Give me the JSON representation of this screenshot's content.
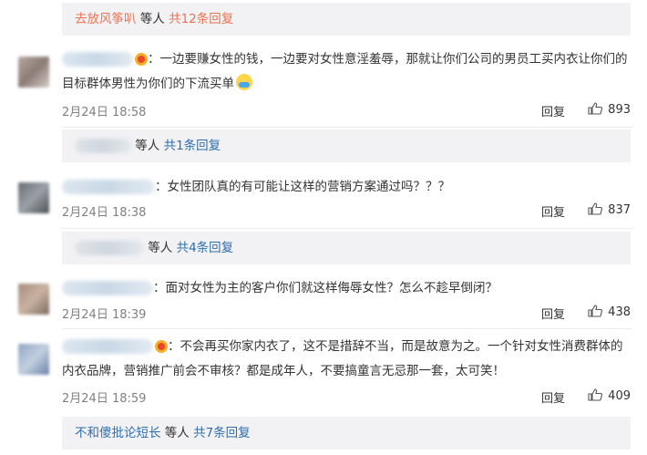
{
  "threads": [
    {
      "reply_user": "去放风筝叭",
      "reply_suffix": "等人",
      "reply_count": "共12条回复"
    },
    {
      "reply_user": "",
      "reply_suffix": "等人",
      "reply_count": "共1条回复"
    },
    {
      "reply_user": "",
      "reply_suffix": "等人",
      "reply_count": "共4条回复"
    },
    {
      "reply_user": "不和傻批论短长",
      "reply_suffix": "等人",
      "reply_count": "共7条回复"
    }
  ],
  "comments": [
    {
      "text": "：一边要赚女性的钱，一边要对女性意淫羞辱，那就让你们公司的男员工买内衣让你们的目标群体男性为你们的下流买单",
      "time": "2月24日 18:58",
      "reply_label": "回复",
      "likes": "893"
    },
    {
      "text": "：女性团队真的有可能让这样的营销方案通过吗？？？",
      "time": "2月24日 18:38",
      "reply_label": "回复",
      "likes": "837"
    },
    {
      "text": "：面对女性为主的客户你们就这样侮辱女性？怎么不趁早倒闭？",
      "time": "2月24日 18:39",
      "reply_label": "回复",
      "likes": "438"
    },
    {
      "text": "：不会再买你家内衣了，这不是措辞不当，而是故意为之。一个针对女性消费群体的内衣品牌，营销推广前会不审核？都是成年人，不要搞童言无忌那一套，太可笑！",
      "time": "2月24日 18:59",
      "reply_label": "回复",
      "likes": "409"
    }
  ],
  "icons": {
    "like": "thumbs-up-icon",
    "vip_badge": "vip-crown-icon",
    "emoji": "fearful-face-emoji-icon"
  },
  "colors": {
    "link_orange": "#eb7350",
    "link_blue": "#2f6eab",
    "meta_gray": "#808080",
    "reply_bg": "#f2f2f5"
  }
}
